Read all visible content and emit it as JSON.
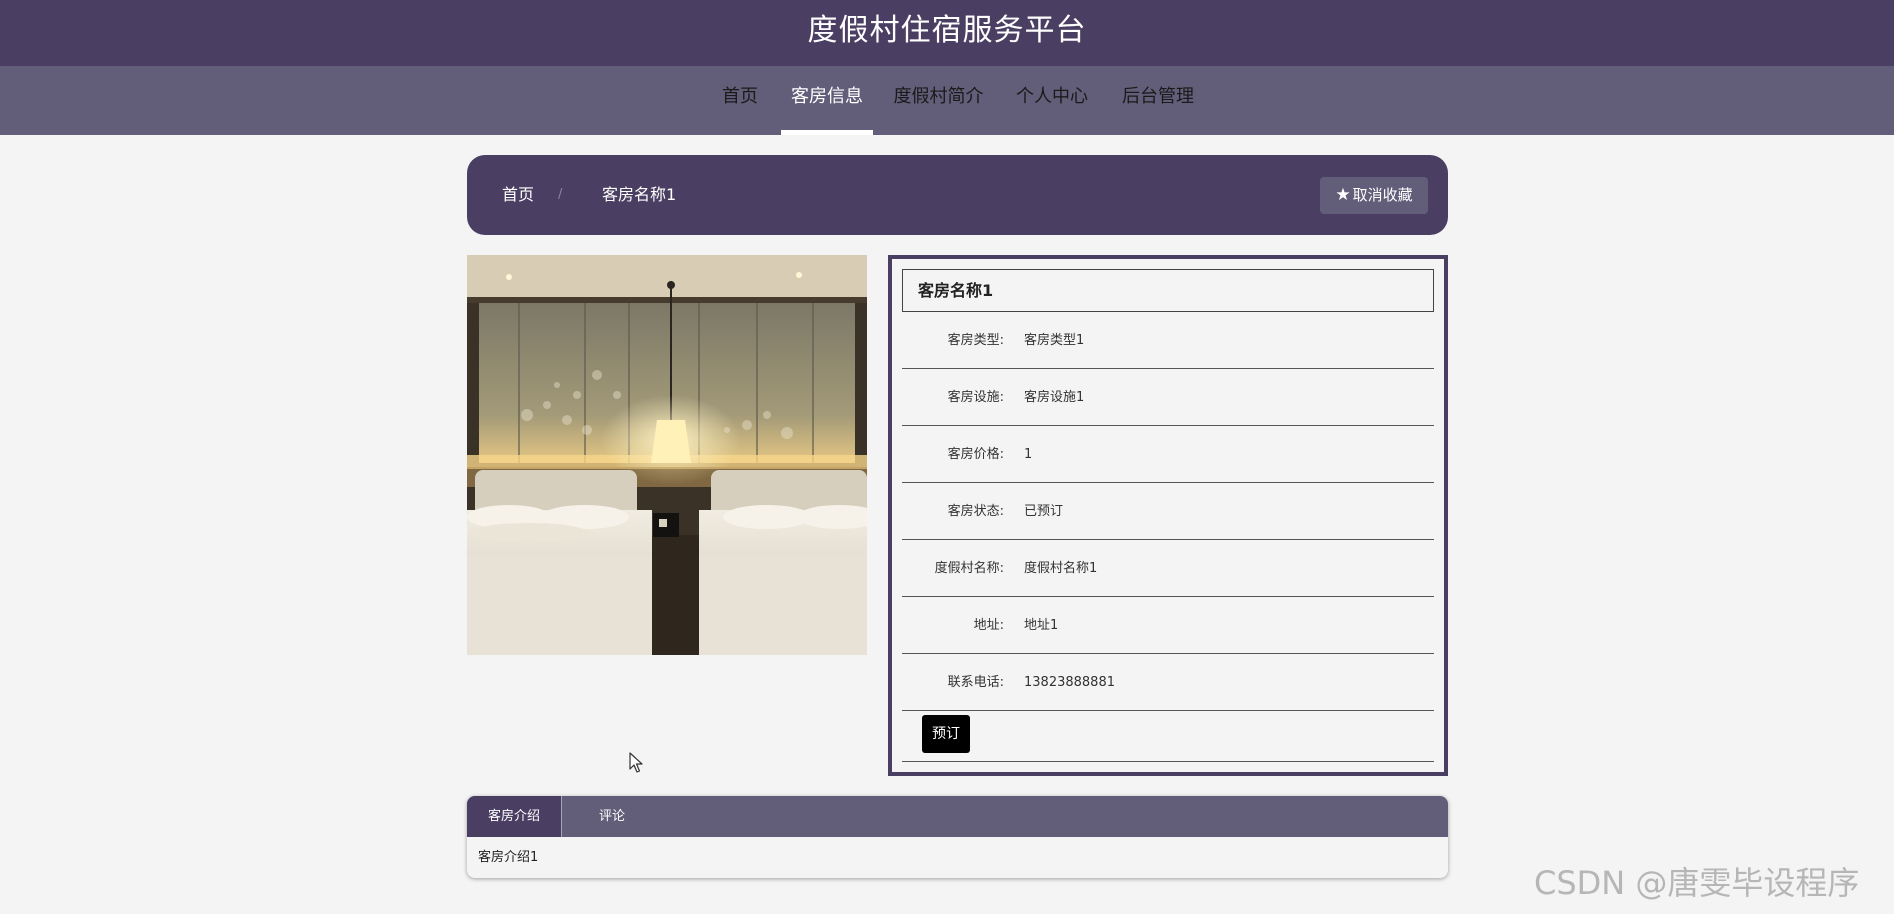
{
  "header": {
    "title": "度假村住宿服务平台"
  },
  "nav": {
    "items": [
      {
        "label": "首页"
      },
      {
        "label": "客房信息"
      },
      {
        "label": "度假村简介"
      },
      {
        "label": "个人中心"
      },
      {
        "label": "后台管理"
      }
    ],
    "active_index": 1
  },
  "breadcrumb": {
    "home": "首页",
    "separator": "/",
    "current": "客房名称1",
    "favorite_button": "取消收藏",
    "favorite_icon": "star-icon"
  },
  "room": {
    "image_alt": "room-photo",
    "title": "客房名称1",
    "fields": [
      {
        "label": "客房类型:",
        "value": "客房类型1"
      },
      {
        "label": "客房设施:",
        "value": "客房设施1"
      },
      {
        "label": "客房价格:",
        "value": "1"
      },
      {
        "label": "客房状态:",
        "value": "已预订"
      },
      {
        "label": "度假村名称:",
        "value": "度假村名称1"
      },
      {
        "label": "地址:",
        "value": "地址1"
      },
      {
        "label": "联系电话:",
        "value": "13823888881"
      }
    ],
    "book_button": "预订"
  },
  "tabs": {
    "items": [
      {
        "label": "客房介绍"
      },
      {
        "label": "评论"
      }
    ],
    "active_index": 0,
    "content": "客房介绍1"
  },
  "watermark": "CSDN @唐雯毕设程序",
  "colors": {
    "header_bg": "#4a3f62",
    "nav_bg": "#625d79",
    "page_bg": "#f4f4f4",
    "book_button_bg": "#000000"
  }
}
